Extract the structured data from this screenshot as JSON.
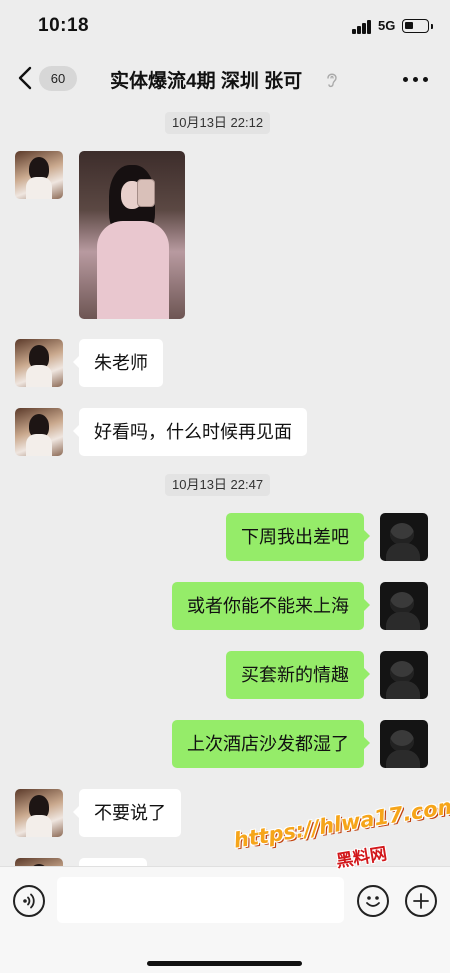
{
  "status_bar": {
    "time": "10:18",
    "network": "5G"
  },
  "nav": {
    "unread_count": "60",
    "title": "实体爆流4期 深圳 张可"
  },
  "timestamps": [
    "10月13日 22:12",
    "10月13日 22:47"
  ],
  "messages": [
    {
      "from": "her",
      "type": "image"
    },
    {
      "from": "her",
      "text": "朱老师"
    },
    {
      "from": "her",
      "text": "好看吗，什么时候再见面"
    },
    {
      "from": "me",
      "text": "下周我出差吧"
    },
    {
      "from": "me",
      "text": "或者你能不能来上海"
    },
    {
      "from": "me",
      "text": "买套新的情趣"
    },
    {
      "from": "me",
      "text": "上次酒店沙发都湿了"
    },
    {
      "from": "her",
      "text": "不要说了"
    }
  ],
  "watermark": {
    "url": "https://hlwa17.com",
    "label": "黑料网"
  },
  "colors": {
    "background": "#ededed",
    "sent_bubble": "#95ec69",
    "received_bubble": "#ffffff"
  },
  "icons": {
    "back": "chevron-left-icon",
    "muted": "ear-icon",
    "more": "ellipsis-icon",
    "voice": "voice-icon",
    "emoji": "emoji-icon",
    "add": "plus-icon"
  }
}
